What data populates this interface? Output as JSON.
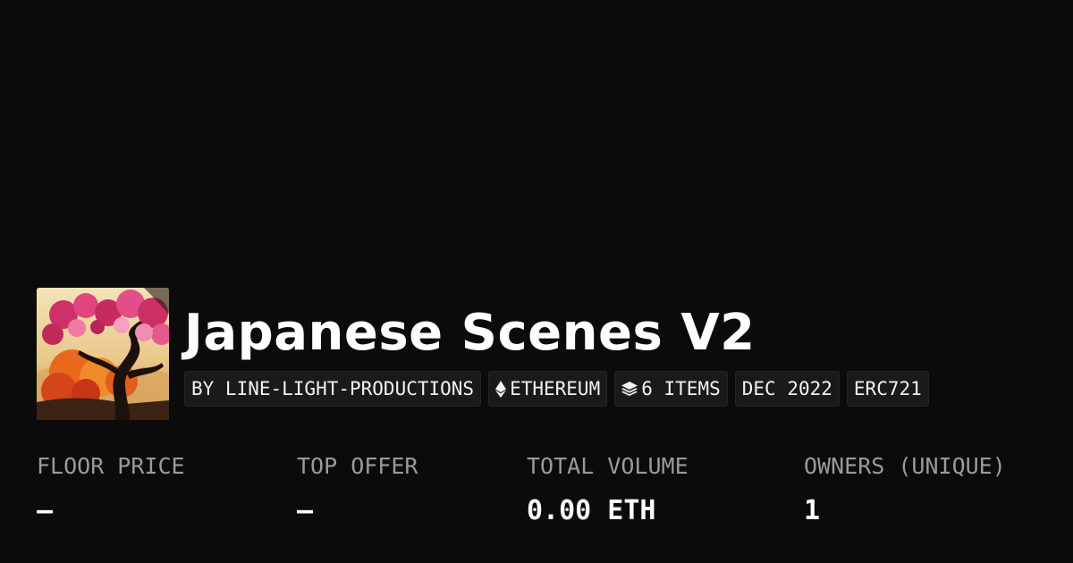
{
  "collection": {
    "title": "Japanese Scenes V2",
    "thumbnail_icon": "collection-artwork-japanese-tree-image"
  },
  "tags": [
    {
      "label": "BY LINE-LIGHT-PRODUCTIONS",
      "icon": ""
    },
    {
      "label": "ETHEREUM",
      "icon": "ethereum-icon"
    },
    {
      "label": "6 ITEMS",
      "icon": "layers-icon"
    },
    {
      "label": "DEC 2022",
      "icon": ""
    },
    {
      "label": "ERC721",
      "icon": ""
    }
  ],
  "stats": [
    {
      "label": "FLOOR PRICE",
      "value": "—"
    },
    {
      "label": "TOP OFFER",
      "value": "—"
    },
    {
      "label": "TOTAL VOLUME",
      "value": "0.00 ETH"
    },
    {
      "label": "OWNERS (UNIQUE)",
      "value": "1"
    }
  ],
  "colors": {
    "background": "#0b0b0b",
    "tag_background": "#1a1a1a",
    "label_gray": "#9a9a9a",
    "text_white": "#ffffff"
  }
}
